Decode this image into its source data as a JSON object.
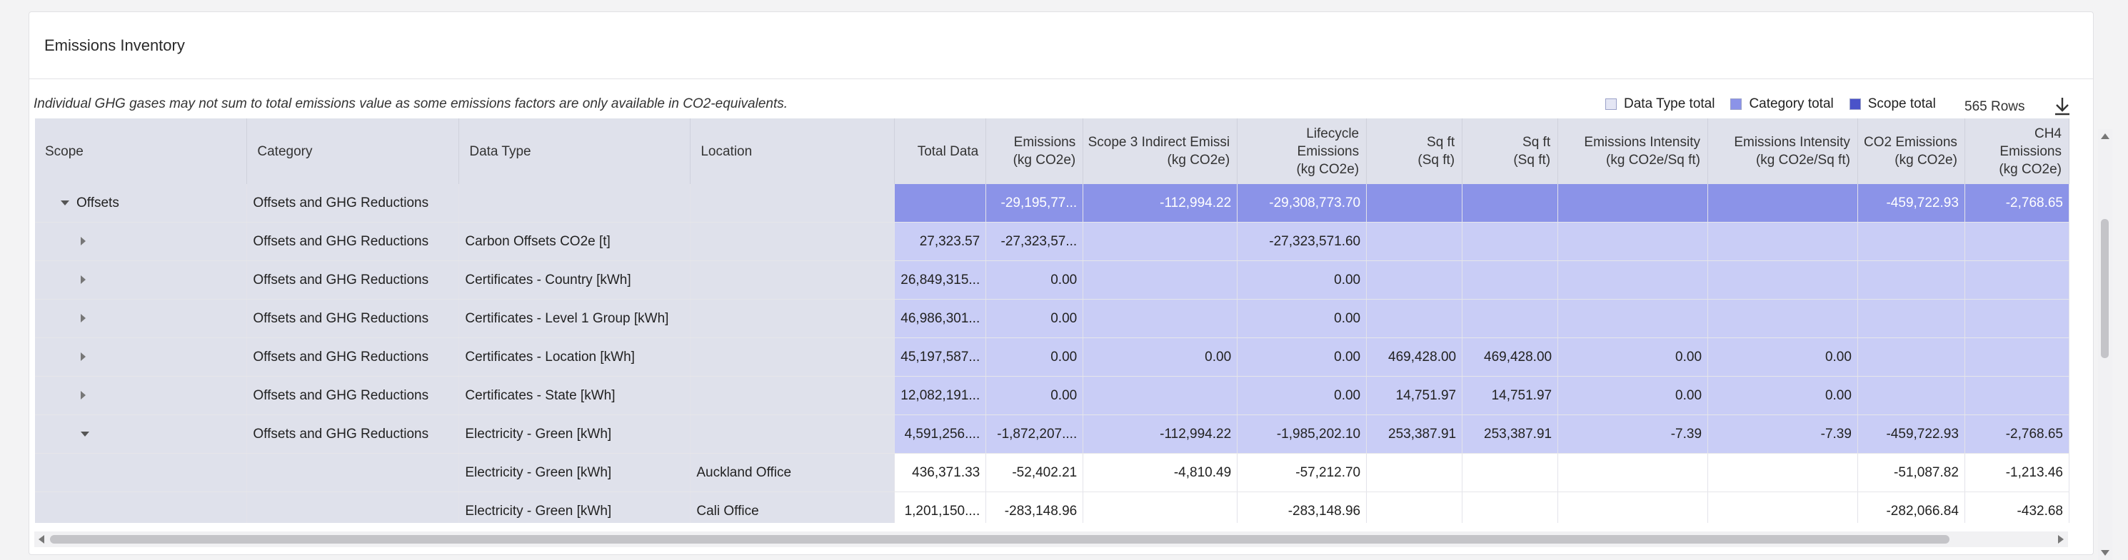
{
  "panel": {
    "title": "Emissions Inventory",
    "note": "Individual GHG gases may not sum to total emissions value as some emissions factors are only available in CO2-equivalents.",
    "rows_count": "565 Rows",
    "download_icon": "download-icon"
  },
  "legend": [
    {
      "label": "Data Type total",
      "color": "#e4e6f4"
    },
    {
      "label": "Category total",
      "color": "#8b93e8"
    },
    {
      "label": "Scope total",
      "color": "#4a53c9"
    }
  ],
  "columns": [
    "Scope",
    "Category",
    "Data Type",
    "Location",
    "Total Data",
    "Emissions\n(kg CO2e)",
    "Scope 3 Indirect Emissi\n(kg CO2e)",
    "Lifecycle Emissions\n(kg CO2e)",
    "Sq ft\n(Sq ft)",
    "Sq ft\n(Sq ft)",
    "Emissions Intensity\n(kg CO2e/Sq ft)",
    "Emissions Intensity\n(kg CO2e/Sq ft)",
    "CO2 Emissions\n(kg CO2e)",
    "CH4 Emissions\n(kg CO2e)"
  ],
  "rows": [
    {
      "kind": "scope",
      "caret": "down",
      "scope": "Offsets",
      "category": "Offsets and GHG Reductions",
      "data_type": "",
      "location": "",
      "values": [
        "",
        "-29,195,77...",
        "-112,994.22",
        "-29,308,773.70",
        "",
        "",
        "",
        "",
        "-459,722.93",
        "-2,768.65"
      ]
    },
    {
      "kind": "cat",
      "caret": "right",
      "scope": "",
      "category": "Offsets and GHG Reductions",
      "data_type": "Carbon Offsets CO2e [t]",
      "location": "",
      "values": [
        "27,323.57",
        "-27,323,57...",
        "",
        "-27,323,571.60",
        "",
        "",
        "",
        "",
        "",
        ""
      ]
    },
    {
      "kind": "cat",
      "caret": "right",
      "scope": "",
      "category": "Offsets and GHG Reductions",
      "data_type": "Certificates - Country [kWh]",
      "location": "",
      "values": [
        "26,849,315...",
        "0.00",
        "",
        "0.00",
        "",
        "",
        "",
        "",
        "",
        ""
      ]
    },
    {
      "kind": "cat",
      "caret": "right",
      "scope": "",
      "category": "Offsets and GHG Reductions",
      "data_type": "Certificates - Level 1 Group [kWh]",
      "location": "",
      "values": [
        "46,986,301...",
        "0.00",
        "",
        "0.00",
        "",
        "",
        "",
        "",
        "",
        ""
      ]
    },
    {
      "kind": "cat",
      "caret": "right",
      "scope": "",
      "category": "Offsets and GHG Reductions",
      "data_type": "Certificates - Location [kWh]",
      "location": "",
      "values": [
        "45,197,587...",
        "0.00",
        "0.00",
        "0.00",
        "469,428.00",
        "469,428.00",
        "0.00",
        "0.00",
        "",
        ""
      ]
    },
    {
      "kind": "cat",
      "caret": "right",
      "scope": "",
      "category": "Offsets and GHG Reductions",
      "data_type": "Certificates - State [kWh]",
      "location": "",
      "values": [
        "12,082,191...",
        "0.00",
        "",
        "0.00",
        "14,751.97",
        "14,751.97",
        "0.00",
        "0.00",
        "",
        ""
      ]
    },
    {
      "kind": "cat",
      "caret": "down",
      "scope": "",
      "category": "Offsets and GHG Reductions",
      "data_type": "Electricity - Green [kWh]",
      "location": "",
      "values": [
        "4,591,256....",
        "-1,872,207....",
        "-112,994.22",
        "-1,985,202.10",
        "253,387.91",
        "253,387.91",
        "-7.39",
        "-7.39",
        "-459,722.93",
        "-2,768.65"
      ]
    },
    {
      "kind": "leaf",
      "caret": "",
      "scope": "",
      "category": "",
      "data_type": "Electricity - Green [kWh]",
      "location": "Auckland Office",
      "values": [
        "436,371.33",
        "-52,402.21",
        "-4,810.49",
        "-57,212.70",
        "",
        "",
        "",
        "",
        "-51,087.82",
        "-1,213.46"
      ]
    },
    {
      "kind": "leaf",
      "caret": "",
      "scope": "",
      "category": "",
      "data_type": "Electricity - Green [kWh]",
      "location": "Cali Office",
      "values": [
        "1,201,150....",
        "-283,148.96",
        "",
        "-283,148.96",
        "",
        "",
        "",
        "",
        "-282,066.84",
        "-432.68"
      ]
    }
  ]
}
